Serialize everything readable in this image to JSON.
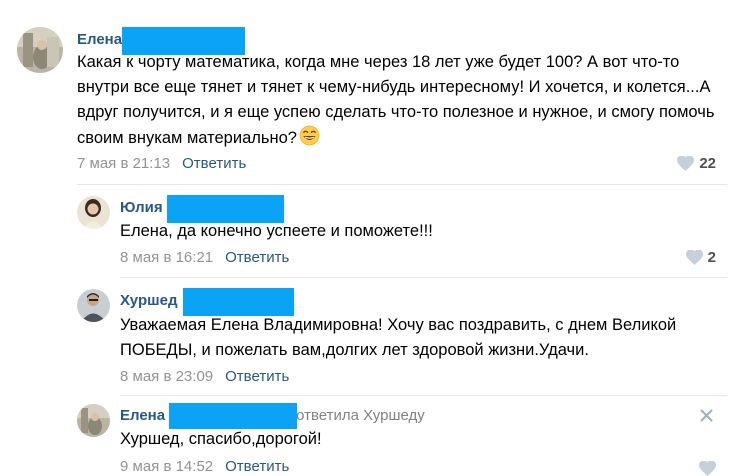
{
  "comments": [
    {
      "author": "Елена",
      "text": "Какая к чорту математика, когда мне через 18 лет уже будет 100? А вот что-то внутри все еще тянет и тянет к чему-нибудь интересному! И хочется, и колется...А вдруг получится, и я еще успею сделать что-то полезное и нужное, и смогу помочь своим внукам материально?",
      "emoji_icon": "grinning-face-icon",
      "date": "7 мая в 21:13",
      "reply_label": "Ответить",
      "likes": "22"
    },
    {
      "author": "Юлия",
      "text": "Елена, да конечно успеете и поможете!!!",
      "date": "8 мая в 16:21",
      "reply_label": "Ответить",
      "likes": "2"
    },
    {
      "author": "Хуршед",
      "text": "Уважаемая Елена Владимировна! Хочу вас поздравить, с днем Великой ПОБЕДЫ, и пожелать вам,долгих лет здоровой жизни.Удачи.",
      "date": "8 мая в 23:09",
      "reply_label": "Ответить"
    },
    {
      "author": "Елена",
      "reply_to": "ответила Хуршеду",
      "text": "Хуршед, спасибо,дорогой!",
      "date": "9 мая в 14:52",
      "reply_label": "Ответить",
      "close_icon": "close-icon"
    }
  ],
  "colors": {
    "author_link": "#2a5885",
    "redaction": "#0aa3f5",
    "meta_gray": "#939393",
    "divider": "#e7e8ec",
    "like_heart": "#c5d0db"
  }
}
